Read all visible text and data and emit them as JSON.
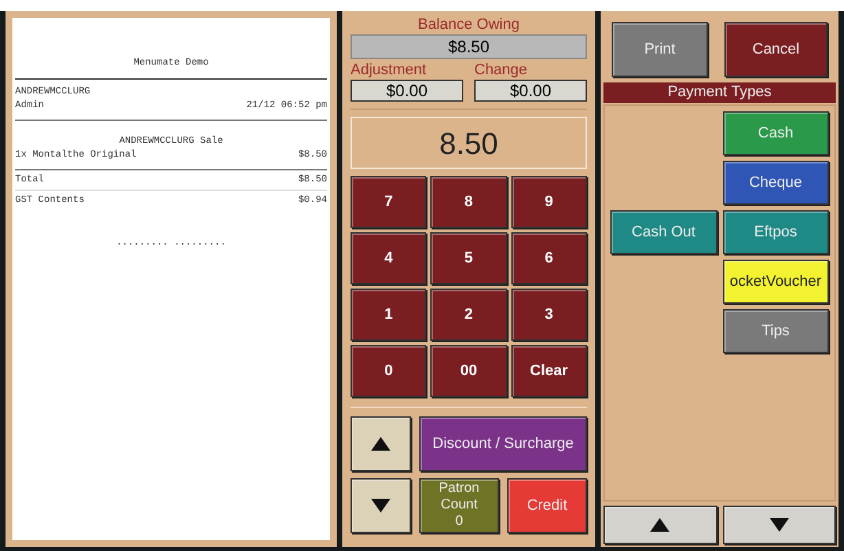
{
  "receipt": {
    "title": "Menumate Demo",
    "header": [
      {
        "left": "ANDREWMCCLURG"
      },
      {
        "left": "Admin",
        "right": "21/12 06:52 pm"
      }
    ],
    "sale_title": "ANDREWMCCLURG Sale",
    "items": [
      {
        "name": "1x Montalthe Original",
        "price": "$8.50"
      }
    ],
    "total": {
      "label": "Total",
      "value": "$8.50"
    },
    "gst": {
      "label": "GST Contents",
      "value": "$0.94"
    },
    "signature": "......... ........."
  },
  "balance": {
    "label": "Balance Owing",
    "value": "$8.50"
  },
  "adjustment": {
    "label": "Adjustment",
    "value": "$0.00"
  },
  "change": {
    "label": "Change",
    "value": "$0.00"
  },
  "display": "8.50",
  "keypad": [
    "7",
    "8",
    "9",
    "4",
    "5",
    "6",
    "1",
    "2",
    "3",
    "0",
    "00",
    "Clear"
  ],
  "discount_button": "Discount / Surcharge",
  "patron_count": {
    "label": "Patron Count",
    "value": "0"
  },
  "credit_button": "Credit",
  "print_button": "Print",
  "cancel_button": "Cancel",
  "payment_types": {
    "title": "Payment Types",
    "cash_out": {
      "label": "Cash Out",
      "color": "#1f8a85"
    },
    "items": [
      {
        "label": "Cash",
        "color": "#2a9a4a"
      },
      {
        "label": "Cheque",
        "color": "#2f55b5"
      },
      {
        "label": "Eftpos",
        "color": "#1f8a85"
      },
      {
        "label": "ocketVoucher",
        "color": "#f2f230"
      },
      {
        "label": "Tips",
        "color": "#7a7a7a"
      }
    ]
  }
}
